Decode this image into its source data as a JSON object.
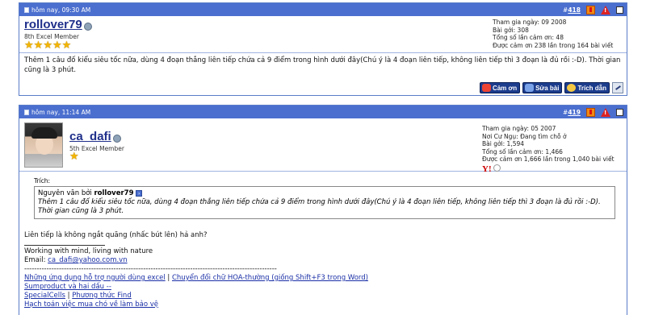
{
  "post1": {
    "header": {
      "time": "hôm nay, 09:30 AM",
      "post_number_prefix": "#",
      "post_number": "418"
    },
    "user": {
      "name": "rollover79",
      "title": "8th Excel Member",
      "stars": 5
    },
    "stats": [
      "Tham gia ngày: 09 2008",
      "Bài gởi: 308",
      "Tổng số lần cảm ơn: 48",
      "Được cảm ơn 238 lần trong 164 bài viết"
    ],
    "body": "Thêm 1 câu đố kiểu siêu tốc nữa, dùng 4 đoạn thẳng liên tiếp chứa cả 9 điểm trong hình dưới đây(Chú ý là 4 đoạn liên tiếp, không liên tiếp thì 3 đoạn là đủ rồi :-D). Thời gian cũng là 3 phút.",
    "buttons": {
      "thanks": "Cảm ơn",
      "edit": "Sửa bài",
      "quote": "Trích dẫn"
    }
  },
  "post2": {
    "header": {
      "time": "hôm nay, 11:14 AM",
      "post_number_prefix": "#",
      "post_number": "419"
    },
    "user": {
      "name": "ca_dafi",
      "title": "5th Excel Member",
      "stars": 1
    },
    "stats": [
      "Tham gia ngày: 05 2007",
      "Nơi Cư Ngụ: Đang tìm chỗ ở",
      "Bài gởi: 1,594",
      "Tổng số lần cảm ơn: 1,466",
      "Được cảm ơn 1,666 lần trong 1,040 bài viết"
    ],
    "yahoo_label": "Y!",
    "quote": {
      "label": "Trích:",
      "by_prefix": "Nguyên văn bởi",
      "by_user": "rollover79",
      "text": "Thêm 1 câu đố kiểu siêu tốc nữa, dùng 4 đoạn thẳng liên tiếp chứa cả 9 điểm trong hình dưới đây(Chú ý là 4 đoạn liên tiếp, không liên tiếp thì 3 đoạn là đủ rồi :-D). Thời gian cũng là 3 phút."
    },
    "body": "Liên tiếp là không ngắt quãng (nhấc bút lên) hả anh?",
    "signature": {
      "line1": "Working with mind, living with nature",
      "email_label": "Email:",
      "email": "ca_dafi@yahoo.com.vn",
      "separator": "------------------------------------------------------------------------------------------------------",
      "links": [
        "Những ứng dụng hỗ trợ người dùng excel",
        "Chuyển đổi chữ HOA-thường (giống Shift+F3 trong Word)",
        "Sumproduct và hai dấu --",
        "SpecialCells",
        "Phương thức Find",
        "Hạch toán việc mua chó về làm bảo vệ"
      ],
      "pipe": "|"
    }
  },
  "colors": {
    "header_bg": "#4b6fcf",
    "username": "#1f2f8a",
    "link": "#1a2fa6",
    "button_bg": "#1c3c8c"
  }
}
